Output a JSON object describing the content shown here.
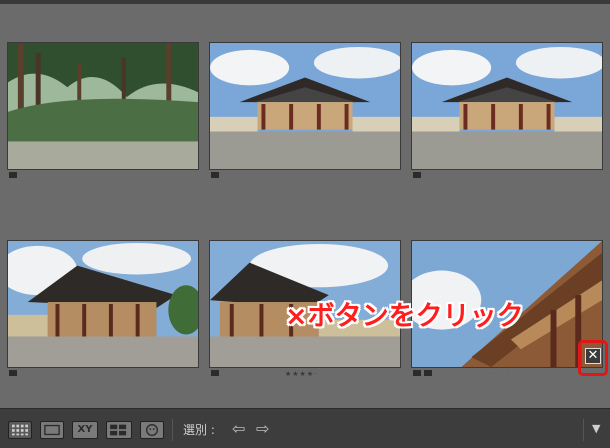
{
  "annotation": {
    "text": "×ボタンをクリック"
  },
  "close_button": {
    "glyph": "✕"
  },
  "cells": [
    {
      "kind": "trees"
    },
    {
      "kind": "gate"
    },
    {
      "kind": "gate"
    },
    {
      "kind": "hall-left"
    },
    {
      "kind": "hall-left",
      "stars": "★★★★·"
    },
    {
      "kind": "eave",
      "stars": "· · · · ·"
    }
  ],
  "toolbar": {
    "select_label": "選別 :",
    "prev_icon": "⇦",
    "next_icon": "⇨",
    "more_icon": "▼",
    "compare_label": "XY"
  },
  "colors": {
    "accent": "#ff1e1e",
    "toolbar_bg": "#3d3d3d",
    "grid_bg": "#6b6b6b"
  }
}
